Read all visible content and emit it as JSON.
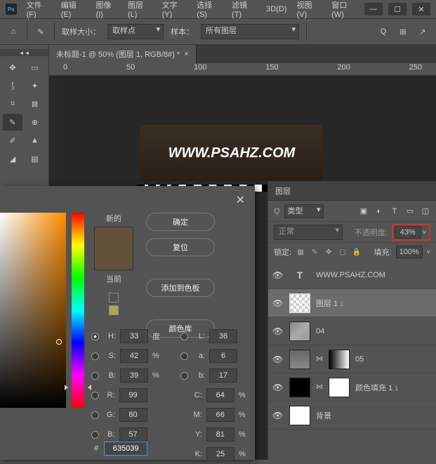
{
  "menu": {
    "file": "文件(F)",
    "edit": "编辑(E)",
    "image": "图像(I)",
    "layer": "图层(L)",
    "text": "文字(Y)",
    "select": "选择(S)",
    "filter": "滤镜(T)",
    "threeD": "3D(D)",
    "view": "视图(V)",
    "window": "窗口(W)"
  },
  "options": {
    "sampleSizeLabel": "取样大小：",
    "sampleSizeValue": "取样点",
    "sampleLabel": "样本：",
    "sampleValue": "所有图层"
  },
  "docTab": "未标题-1 @ 50% (图层 1, RGB/8#) *",
  "ruler": [
    "0",
    "50",
    "100",
    "150",
    "200",
    "250"
  ],
  "canvasText": "WWW.PSAHZ.COM",
  "picker": {
    "newLabel": "新的",
    "currentLabel": "当前",
    "buttons": {
      "ok": "确定",
      "reset": "复位",
      "addSwatch": "添加到色板",
      "colorLib": "颜色库"
    },
    "H": {
      "l": "H:",
      "v": "33",
      "u": "度"
    },
    "S": {
      "l": "S:",
      "v": "42",
      "u": "%"
    },
    "B": {
      "l": "B:",
      "v": "39",
      "u": "%"
    },
    "R": {
      "l": "R:",
      "v": "99"
    },
    "G": {
      "l": "G:",
      "v": "80"
    },
    "Bb": {
      "l": "B:",
      "v": "57"
    },
    "L": {
      "l": "L:",
      "v": "36"
    },
    "a": {
      "l": "a:",
      "v": "6"
    },
    "b2": {
      "l": "b:",
      "v": "17"
    },
    "C": {
      "l": "C:",
      "v": "64",
      "u": "%"
    },
    "M": {
      "l": "M:",
      "v": "66",
      "u": "%"
    },
    "Y": {
      "l": "Y:",
      "v": "81",
      "u": "%"
    },
    "K": {
      "l": "K:",
      "v": "25",
      "u": "%"
    },
    "hex": "635039"
  },
  "layers": {
    "title": "图层",
    "typeLabel": "类型",
    "blend": "正常",
    "opacityLabel": "不透明度:",
    "opacityValue": "43%",
    "lockLabel": "锁定:",
    "fillLabel": "填充:",
    "fillValue": "100%",
    "items": [
      {
        "name": "WWW.PSAHZ.COM",
        "type": "T"
      },
      {
        "name": "图层 1",
        "sub": "1",
        "type": "checker",
        "sel": true
      },
      {
        "name": "04",
        "type": "tex"
      },
      {
        "name": "05",
        "type": "img",
        "mask": "grad"
      },
      {
        "name": "颜色填充 1",
        "sub": "1",
        "type": "black",
        "mask": "white"
      },
      {
        "name": "背景",
        "type": "white"
      }
    ]
  }
}
